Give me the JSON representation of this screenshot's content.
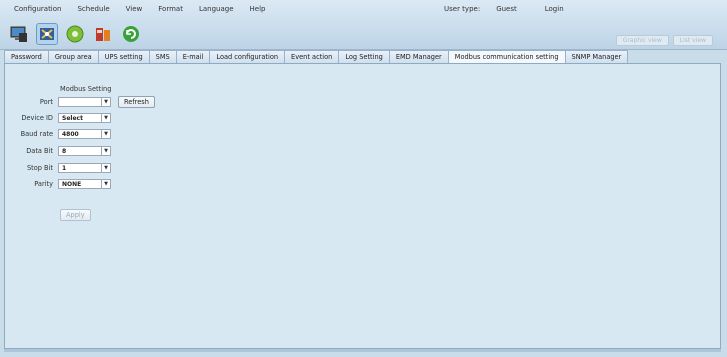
{
  "menu": [
    "Configuration",
    "Schedule",
    "View",
    "Format",
    "Language",
    "Help"
  ],
  "user": {
    "label": "User type:",
    "value": "Guest",
    "login": "Login"
  },
  "right_buttons": [
    "Graphic view",
    "List view"
  ],
  "tabs": [
    "Password",
    "Group area",
    "UPS setting",
    "SMS",
    "E-mail",
    "Load configuration",
    "Event action",
    "Log Setting",
    "EMD Manager",
    "Modbus communication setting",
    "SNMP Manager"
  ],
  "active_tab": "Modbus communication setting",
  "modbus": {
    "title": "Modbus Setting",
    "port": {
      "label": "Port",
      "value": ""
    },
    "refresh": "Refresh",
    "device_id": {
      "label": "Device ID",
      "value": "Select"
    },
    "baud_rate": {
      "label": "Baud rate",
      "value": "4800"
    },
    "data_bit": {
      "label": "Data Bit",
      "value": "8"
    },
    "stop_bit": {
      "label": "Stop Bit",
      "value": "1"
    },
    "parity": {
      "label": "Parity",
      "value": "NONE"
    },
    "apply": "Apply"
  }
}
